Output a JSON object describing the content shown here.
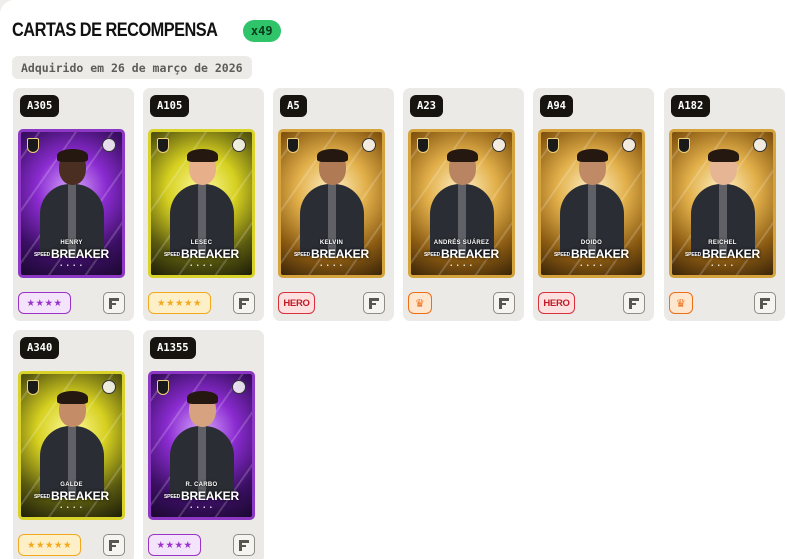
{
  "header": {
    "title": "CARTAS DE RECOMPENSA",
    "count": "x49"
  },
  "acquired": "Adquirido em 26 de março de 2026",
  "colors": {
    "count_badge": "#2fc46a",
    "stars4": "#9c33c9",
    "stars5": "#f2a91f",
    "hero": "#d9313b",
    "crown": "#ee6f16"
  },
  "cards": [
    {
      "code": "A305",
      "player": "HENRY",
      "brand": "BREAKER",
      "brand_prefix": "SPEED",
      "theme": "purple",
      "rarity": "stars4",
      "rarity_text": "★★★★",
      "skin": "#4a2e22"
    },
    {
      "code": "A105",
      "player": "LESEC",
      "brand": "BREAKER",
      "brand_prefix": "SPEED",
      "theme": "yellow",
      "rarity": "stars5",
      "rarity_text": "★★★★★",
      "skin": "#e7b08a"
    },
    {
      "code": "A5",
      "player": "KELVIN",
      "brand": "BREAKER",
      "brand_prefix": "SPEED",
      "theme": "gold",
      "rarity": "hero",
      "rarity_text": "HERO",
      "skin": "#b07a55"
    },
    {
      "code": "A23",
      "player": "ANDRÉS SUÁREZ",
      "brand": "BREAKER",
      "brand_prefix": "SPEED",
      "theme": "gold",
      "rarity": "crown",
      "rarity_text": "♛",
      "skin": "#b98462"
    },
    {
      "code": "A94",
      "player": "DOIDO",
      "brand": "BREAKER",
      "brand_prefix": "SPEED",
      "theme": "gold",
      "rarity": "hero",
      "rarity_text": "HERO",
      "skin": "#c08a66"
    },
    {
      "code": "A182",
      "player": "REICHEL",
      "brand": "BREAKER",
      "brand_prefix": "SPEED",
      "theme": "gold",
      "rarity": "crown",
      "rarity_text": "♛",
      "skin": "#e6b694"
    },
    {
      "code": "A340",
      "player": "GALDE",
      "brand": "BREAKER",
      "brand_prefix": "SPEED",
      "theme": "yellow",
      "rarity": "stars5",
      "rarity_text": "★★★★★",
      "skin": "#c48d68"
    },
    {
      "code": "A1355",
      "player": "R. CARBO",
      "brand": "BREAKER",
      "brand_prefix": "SPEED",
      "theme": "purple",
      "rarity": "stars4",
      "rarity_text": "★★★★",
      "skin": "#d6a27f"
    }
  ],
  "icons": {
    "card_action": "f-square-icon",
    "crown": "crown-icon",
    "star": "star-icon"
  }
}
